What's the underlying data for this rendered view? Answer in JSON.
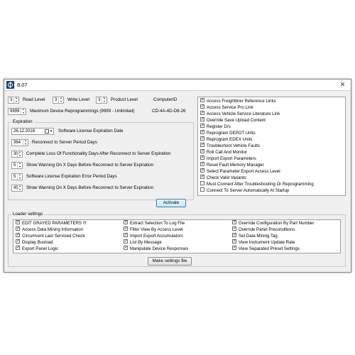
{
  "window": {
    "title": "8.07",
    "close_glyph": "✕"
  },
  "levels": {
    "read_value": "3",
    "read_label": "Read Level",
    "write_value": "3",
    "write_label": "Write Level",
    "product_value": "3",
    "product_label": "Product Level",
    "computer_id_label": "ComputerID",
    "computer_id_value": "CD-4A-4D-D8-26"
  },
  "max_reprog": {
    "value": "9999",
    "label": "Maximum Device Reprogrammings (9999 - Unlimited)"
  },
  "expiration": {
    "group_label": "Expiration",
    "date_value": "26.12.2018",
    "date_label": "Software License Expiration Date",
    "rows": [
      {
        "value": "364",
        "label": "Reconnect to Server Period Days"
      },
      {
        "value": "30",
        "label": "Complete Loss Of Functionality Days After Reconnect to Server Expiration"
      },
      {
        "value": "5",
        "label": "Show Warning On X Days Before Reconnect to Server Expiration"
      },
      {
        "value": "5",
        "label": "Software License Expiration Error Period Days"
      },
      {
        "value": "45",
        "label": "Show Warning On X Days Before Reconnect to Server Expiration"
      }
    ]
  },
  "activate_button": "Activate",
  "permissions": [
    {
      "label": "Access Freightliner Reference Links",
      "checked": true
    },
    {
      "label": "Access Service Pro Link",
      "checked": true
    },
    {
      "label": "Access Vehicle Service Literature Link",
      "checked": true
    },
    {
      "label": "Override Save Upload Content",
      "checked": true
    },
    {
      "label": "Register Drs",
      "checked": true
    },
    {
      "label": "Reprogram DEPOT Units",
      "checked": true
    },
    {
      "label": "Reprogram EDEX Units",
      "checked": true
    },
    {
      "label": "Troubleshoot Vehicle Faults",
      "checked": true
    },
    {
      "label": "Roll Call And Monitor",
      "checked": true
    },
    {
      "label": "Import Export Parameters",
      "checked": true
    },
    {
      "label": "Reset Fault Memory Manager",
      "checked": true
    },
    {
      "label": "Select Parameter Export Access Level",
      "checked": true
    },
    {
      "label": "Check Valid Variants",
      "checked": true
    },
    {
      "label": "Must Connect After Troubleshooting Or Reprogramming",
      "checked": false
    },
    {
      "label": "Connect To Server Automatically At Startup",
      "checked": false
    }
  ],
  "loader": {
    "group_label": "Loader settings",
    "col1": [
      {
        "label": "EDIT GRAYED PARAMETERS !!!",
        "checked": true
      },
      {
        "label": "Access Data Mining Information",
        "checked": true
      },
      {
        "label": "Circumvent Last Serviced Check",
        "checked": true
      },
      {
        "label": "Display Busload",
        "checked": true
      },
      {
        "label": "Export Panel Logic",
        "checked": true
      }
    ],
    "col2": [
      {
        "label": "Extract Selection To Log File",
        "checked": true
      },
      {
        "label": "Filter View By Access Level",
        "checked": true
      },
      {
        "label": "Import Export Accumulators",
        "checked": true
      },
      {
        "label": "List By Message",
        "checked": true
      },
      {
        "label": "Manipulate Device Responses",
        "checked": true
      }
    ],
    "col3": [
      {
        "label": "Override Configuration By Part Number",
        "checked": true
      },
      {
        "label": "Override Panel Preconditions",
        "checked": true
      },
      {
        "label": "Set Data Mining Tag",
        "checked": true
      },
      {
        "label": "View Instrument Update Rate",
        "checked": true
      },
      {
        "label": "View Separated Preset Settings",
        "checked": true
      }
    ],
    "make_button": "Make settings file"
  }
}
